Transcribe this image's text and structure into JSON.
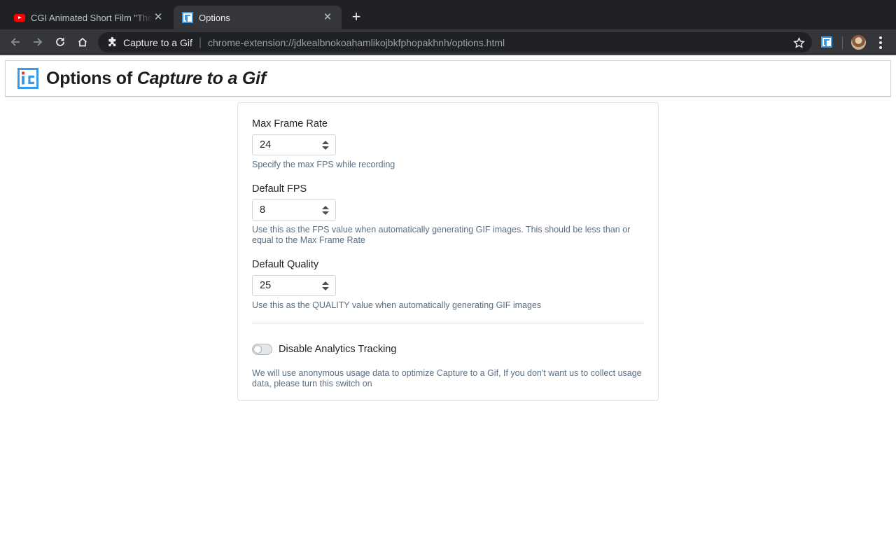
{
  "tabs": [
    {
      "title": "CGI Animated Short Film \"The G",
      "favicon": "youtube-icon",
      "active": false
    },
    {
      "title": "Options",
      "favicon": "capture-to-gif-icon",
      "active": true
    }
  ],
  "toolbar": {
    "site_name": "Capture to a Gif",
    "url": "chrome-extension://jdkealbnokoahamlikojbkfphopakhnh/options.html"
  },
  "header": {
    "title_prefix": "Options of ",
    "title_emphasis": "Capture to a Gif"
  },
  "settings": {
    "max_frame_rate": {
      "label": "Max Frame Rate",
      "value": "24",
      "help": "Specify the max FPS while recording"
    },
    "default_fps": {
      "label": "Default FPS",
      "value": "8",
      "help": "Use this as the FPS value when automatically generating GIF images. This should be less than or equal to the Max Frame Rate"
    },
    "default_quality": {
      "label": "Default Quality",
      "value": "25",
      "help": "Use this as the QUALITY value when automatically generating GIF images"
    },
    "analytics": {
      "label": "Disable Analytics Tracking",
      "enabled": false,
      "help": "We will use anonymous usage data to optimize Capture to a Gif, If you don't want us to collect usage data, please turn this switch on"
    }
  },
  "colors": {
    "accent": "#3a9ae6",
    "logo_red": "#e53935",
    "browser_frame": "#202124",
    "toolbar": "#35363a"
  }
}
